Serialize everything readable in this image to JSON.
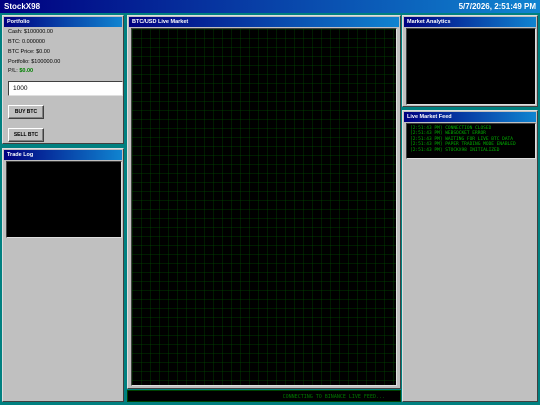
{
  "app": {
    "title": "StockX98",
    "datetime": "5/7/2026, 2:51:49 PM"
  },
  "portfolio": {
    "title": "Portfolio",
    "cash": "Cash: $100000.00",
    "btc": "BTC: 0.000000",
    "btc_price": "BTC Price: $0.00",
    "portfolio_value": "Portfolio: $100000.00",
    "pl_label": "P/L:",
    "pl_value": "$0.00",
    "quantity_value": "1000",
    "buy_label": "BUY BTC",
    "sell_label": "SELL BTC"
  },
  "trade_log": {
    "title": "Trade Log"
  },
  "market": {
    "title": "BTC/USD Live Market",
    "status": "CONNECTING TO BINANCE LIVE FEED..."
  },
  "analytics": {
    "title": "Market Analytics"
  },
  "feed": {
    "title": "Live Market Feed",
    "lines": [
      "[2:51:43 PM] CONNECTION CLOSED",
      "[2:51:43 PM] WEBSOCKET ERROR",
      "[2:51:43 PM] WAITING FOR LIVE BTC DATA",
      "[2:51:43 PM] PAPER TRADING MODE ENABLED",
      "[2:51:43 PM] STOCKX98 INITIALIZED"
    ]
  },
  "colors": {
    "desktop": "#008080",
    "title_bar": "#000080",
    "terminal_text": "#00b000",
    "profit": "#008000"
  }
}
